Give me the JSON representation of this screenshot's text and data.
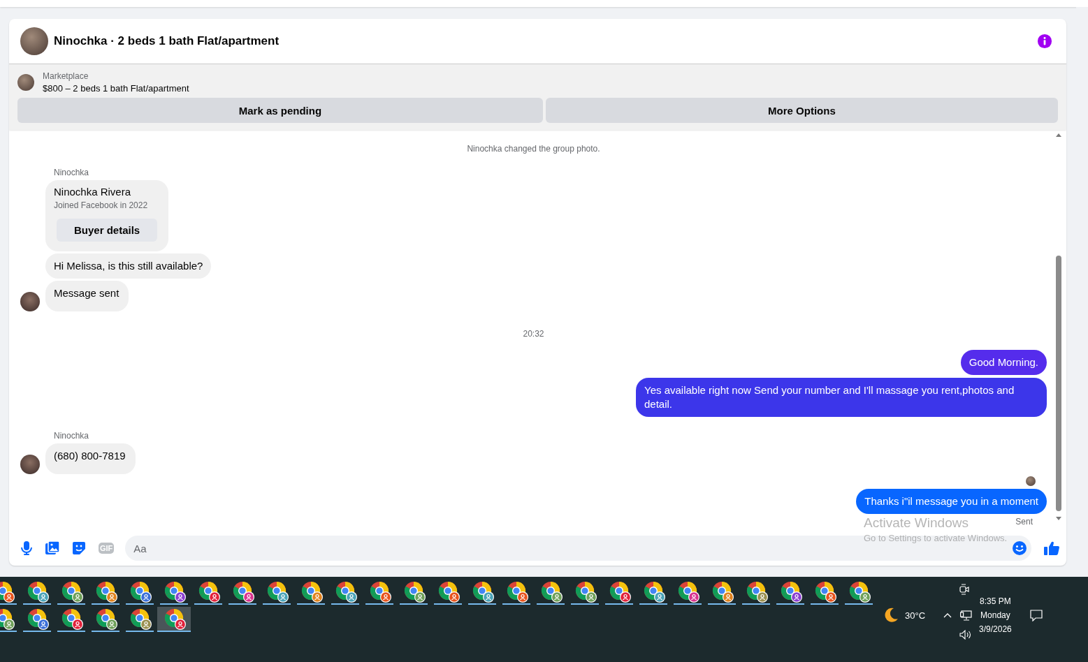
{
  "conversation": {
    "title": "Ninochka · 2 beds 1 bath Flat/apartment"
  },
  "listing": {
    "source": "Marketplace",
    "summary": "$800 – 2 beds 1 bath Flat/apartment",
    "actions": [
      "Mark as pending",
      "More Options"
    ]
  },
  "messages": [
    {
      "kind": "system",
      "text": "Ninochka changed the group photo."
    },
    {
      "kind": "sender",
      "text": "Ninochka"
    },
    {
      "kind": "profile",
      "name": "Ninochka Rivera",
      "detail": "Joined Facebook in 2022",
      "action": "Buyer details"
    },
    {
      "kind": "incoming",
      "text": "Hi Melissa, is this still available?",
      "avatar": false
    },
    {
      "kind": "incoming",
      "text": "Message sent",
      "avatar": true
    },
    {
      "kind": "time",
      "text": "20:32"
    },
    {
      "kind": "outgoing",
      "text": "Good Morning.",
      "color": "#552cec"
    },
    {
      "kind": "outgoing",
      "text": "Yes available right now Send your number and I'll massage you rent,photos and detail.",
      "color": "#3c36ea"
    },
    {
      "kind": "sender",
      "text": "Ninochka"
    },
    {
      "kind": "incoming",
      "text": "(680) 800-7819",
      "avatar": true
    },
    {
      "kind": "seen"
    },
    {
      "kind": "outgoing",
      "text": "Thanks i\"il message you in a moment",
      "color": "#0866ff"
    },
    {
      "kind": "status",
      "text": "Sent"
    }
  ],
  "composer": {
    "gif_label": "GIF",
    "placeholder": "Aa"
  },
  "watermark": {
    "title": "Activate Windows",
    "subtitle": "Go to Settings to activate Windows."
  },
  "taskbar": {
    "windows": [
      {
        "color": "#e8531c",
        "selected": false
      },
      {
        "color": "#4aa3b8",
        "selected": false
      },
      {
        "color": "#6fa05a",
        "selected": false
      },
      {
        "color": "#e0821e",
        "selected": false
      },
      {
        "color": "#3b6fd8",
        "selected": false
      },
      {
        "color": "#8a3fd0",
        "selected": false
      },
      {
        "color": "#e2213a",
        "selected": false
      },
      {
        "color": "#d9338f",
        "selected": false
      },
      {
        "color": "#4aa3b8",
        "selected": false
      },
      {
        "color": "#e0821e",
        "selected": false
      },
      {
        "color": "#4aa3b8",
        "selected": false
      },
      {
        "color": "#e8531c",
        "selected": false
      },
      {
        "color": "#6fa05a",
        "selected": false
      },
      {
        "color": "#e8531c",
        "selected": false
      },
      {
        "color": "#4aa3b8",
        "selected": false
      },
      {
        "color": "#e8531c",
        "selected": false
      },
      {
        "color": "#6fa05a",
        "selected": false
      },
      {
        "color": "#6fa05a",
        "selected": false
      },
      {
        "color": "#e2213a",
        "selected": false
      },
      {
        "color": "#4aa3b8",
        "selected": false
      },
      {
        "color": "#d9338f",
        "selected": false
      },
      {
        "color": "#e0821e",
        "selected": false
      },
      {
        "color": "#9a9050",
        "selected": false
      },
      {
        "color": "#8a3fd0",
        "selected": false
      },
      {
        "color": "#e8531c",
        "selected": false
      },
      {
        "color": "#6fa05a",
        "selected": false
      },
      {
        "color": "#6fa05a",
        "selected": false
      },
      {
        "color": "#3b6fd8",
        "selected": false
      },
      {
        "color": "#e2213a",
        "selected": false
      },
      {
        "color": "#6fa05a",
        "selected": false
      },
      {
        "color": "#9a9050",
        "selected": false
      },
      {
        "color": "#e2213a",
        "selected": true
      }
    ],
    "weather": "30°C",
    "time": "8:35 PM",
    "day": "Monday",
    "date": "3/9/2026"
  }
}
